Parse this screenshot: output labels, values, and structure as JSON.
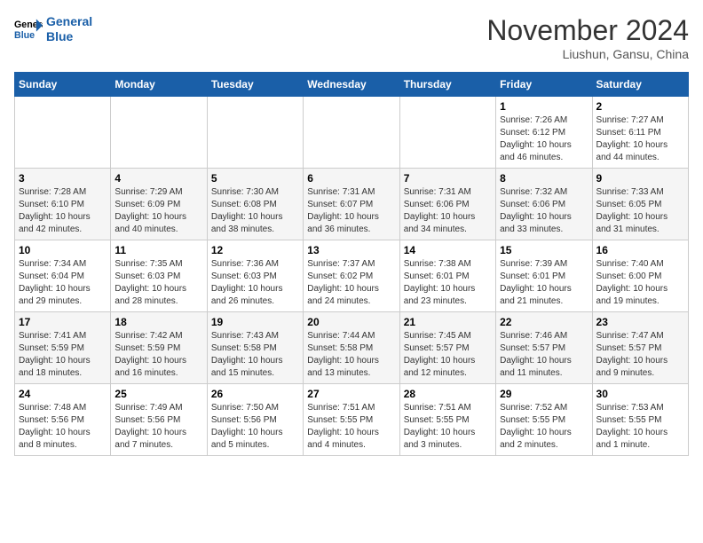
{
  "header": {
    "logo_line1": "General",
    "logo_line2": "Blue",
    "month": "November 2024",
    "location": "Liushun, Gansu, China"
  },
  "weekdays": [
    "Sunday",
    "Monday",
    "Tuesday",
    "Wednesday",
    "Thursday",
    "Friday",
    "Saturday"
  ],
  "weeks": [
    [
      {
        "day": "",
        "info": ""
      },
      {
        "day": "",
        "info": ""
      },
      {
        "day": "",
        "info": ""
      },
      {
        "day": "",
        "info": ""
      },
      {
        "day": "",
        "info": ""
      },
      {
        "day": "1",
        "info": "Sunrise: 7:26 AM\nSunset: 6:12 PM\nDaylight: 10 hours\nand 46 minutes."
      },
      {
        "day": "2",
        "info": "Sunrise: 7:27 AM\nSunset: 6:11 PM\nDaylight: 10 hours\nand 44 minutes."
      }
    ],
    [
      {
        "day": "3",
        "info": "Sunrise: 7:28 AM\nSunset: 6:10 PM\nDaylight: 10 hours\nand 42 minutes."
      },
      {
        "day": "4",
        "info": "Sunrise: 7:29 AM\nSunset: 6:09 PM\nDaylight: 10 hours\nand 40 minutes."
      },
      {
        "day": "5",
        "info": "Sunrise: 7:30 AM\nSunset: 6:08 PM\nDaylight: 10 hours\nand 38 minutes."
      },
      {
        "day": "6",
        "info": "Sunrise: 7:31 AM\nSunset: 6:07 PM\nDaylight: 10 hours\nand 36 minutes."
      },
      {
        "day": "7",
        "info": "Sunrise: 7:31 AM\nSunset: 6:06 PM\nDaylight: 10 hours\nand 34 minutes."
      },
      {
        "day": "8",
        "info": "Sunrise: 7:32 AM\nSunset: 6:06 PM\nDaylight: 10 hours\nand 33 minutes."
      },
      {
        "day": "9",
        "info": "Sunrise: 7:33 AM\nSunset: 6:05 PM\nDaylight: 10 hours\nand 31 minutes."
      }
    ],
    [
      {
        "day": "10",
        "info": "Sunrise: 7:34 AM\nSunset: 6:04 PM\nDaylight: 10 hours\nand 29 minutes."
      },
      {
        "day": "11",
        "info": "Sunrise: 7:35 AM\nSunset: 6:03 PM\nDaylight: 10 hours\nand 28 minutes."
      },
      {
        "day": "12",
        "info": "Sunrise: 7:36 AM\nSunset: 6:03 PM\nDaylight: 10 hours\nand 26 minutes."
      },
      {
        "day": "13",
        "info": "Sunrise: 7:37 AM\nSunset: 6:02 PM\nDaylight: 10 hours\nand 24 minutes."
      },
      {
        "day": "14",
        "info": "Sunrise: 7:38 AM\nSunset: 6:01 PM\nDaylight: 10 hours\nand 23 minutes."
      },
      {
        "day": "15",
        "info": "Sunrise: 7:39 AM\nSunset: 6:01 PM\nDaylight: 10 hours\nand 21 minutes."
      },
      {
        "day": "16",
        "info": "Sunrise: 7:40 AM\nSunset: 6:00 PM\nDaylight: 10 hours\nand 19 minutes."
      }
    ],
    [
      {
        "day": "17",
        "info": "Sunrise: 7:41 AM\nSunset: 5:59 PM\nDaylight: 10 hours\nand 18 minutes."
      },
      {
        "day": "18",
        "info": "Sunrise: 7:42 AM\nSunset: 5:59 PM\nDaylight: 10 hours\nand 16 minutes."
      },
      {
        "day": "19",
        "info": "Sunrise: 7:43 AM\nSunset: 5:58 PM\nDaylight: 10 hours\nand 15 minutes."
      },
      {
        "day": "20",
        "info": "Sunrise: 7:44 AM\nSunset: 5:58 PM\nDaylight: 10 hours\nand 13 minutes."
      },
      {
        "day": "21",
        "info": "Sunrise: 7:45 AM\nSunset: 5:57 PM\nDaylight: 10 hours\nand 12 minutes."
      },
      {
        "day": "22",
        "info": "Sunrise: 7:46 AM\nSunset: 5:57 PM\nDaylight: 10 hours\nand 11 minutes."
      },
      {
        "day": "23",
        "info": "Sunrise: 7:47 AM\nSunset: 5:57 PM\nDaylight: 10 hours\nand 9 minutes."
      }
    ],
    [
      {
        "day": "24",
        "info": "Sunrise: 7:48 AM\nSunset: 5:56 PM\nDaylight: 10 hours\nand 8 minutes."
      },
      {
        "day": "25",
        "info": "Sunrise: 7:49 AM\nSunset: 5:56 PM\nDaylight: 10 hours\nand 7 minutes."
      },
      {
        "day": "26",
        "info": "Sunrise: 7:50 AM\nSunset: 5:56 PM\nDaylight: 10 hours\nand 5 minutes."
      },
      {
        "day": "27",
        "info": "Sunrise: 7:51 AM\nSunset: 5:55 PM\nDaylight: 10 hours\nand 4 minutes."
      },
      {
        "day": "28",
        "info": "Sunrise: 7:51 AM\nSunset: 5:55 PM\nDaylight: 10 hours\nand 3 minutes."
      },
      {
        "day": "29",
        "info": "Sunrise: 7:52 AM\nSunset: 5:55 PM\nDaylight: 10 hours\nand 2 minutes."
      },
      {
        "day": "30",
        "info": "Sunrise: 7:53 AM\nSunset: 5:55 PM\nDaylight: 10 hours\nand 1 minute."
      }
    ]
  ]
}
